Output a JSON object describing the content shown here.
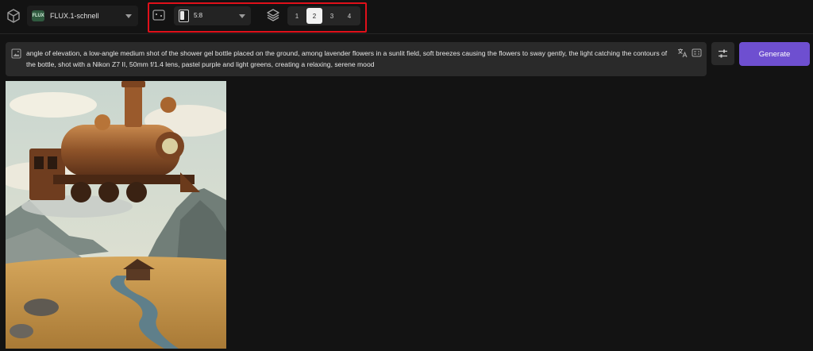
{
  "toolbar": {
    "model": {
      "label": "FLUX.1-schnell",
      "badge": "FLUX"
    },
    "aspect_ratio": {
      "selected": "5:8"
    },
    "image_count": {
      "options": [
        "1",
        "2",
        "3",
        "4"
      ],
      "selected": "2"
    }
  },
  "prompt": {
    "text": "angle of elevation, a low-angle medium shot of the shower gel bottle placed on the ground, among lavender flowers in a sunlit field, soft breezes causing the flowers to sway gently, the light catching the contours of the bottle, shot with a Nikon Z7 II, 50mm f/1.4 lens, pastel purple and light greens, creating a relaxing, serene mood"
  },
  "actions": {
    "generate_label": "Generate"
  },
  "icons": {
    "app": "cube-icon",
    "aspect": "aspect-ratio-icon",
    "layers": "layers-icon",
    "prompt_image": "image-icon",
    "translate": "translate-icon",
    "caption": "caption-icon",
    "settings": "sliders-icon"
  },
  "colors": {
    "background": "#131313",
    "accent": "#6e4fd0",
    "highlight": "#e0101a",
    "panel": "#2a2a2a"
  }
}
